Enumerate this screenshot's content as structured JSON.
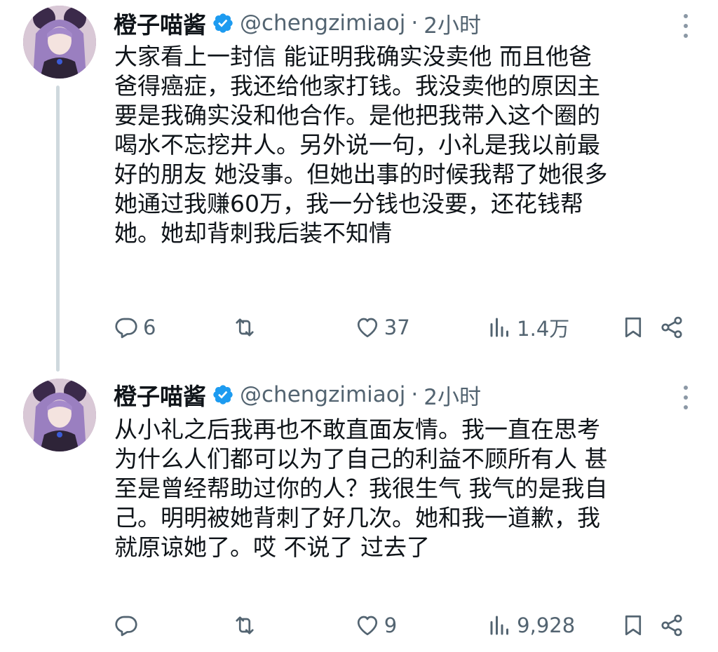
{
  "colors": {
    "text": "#0f1419",
    "secondary": "#536471",
    "verified": "#1d9bf0",
    "thread_line": "#cfd9de"
  },
  "icons": [
    "verified-badge-icon",
    "more-icon",
    "reply-icon",
    "retweet-icon",
    "like-icon",
    "views-icon",
    "bookmark-icon",
    "share-icon"
  ],
  "tweets": [
    {
      "name": "橙子喵酱",
      "handle": "@chengzimiaoj",
      "separator": "·",
      "time": "2小时",
      "text": "大家看上一封信 能证明我确实没卖他 而且他爸\n爸得癌症，我还给他家打钱。我没卖他的原因主\n要是我确实没和他合作。是他把我带入这个圈的\n喝水不忘挖井人。另外说一句，小礼是我以前最\n好的朋友 她没事。但她出事的时候我帮了她很多\n她通过我赚60万，我一分钱也没要，还花钱帮\n她。她却背刺我后装不知情",
      "replies": "6",
      "retweets": "",
      "likes": "37",
      "views": "1.4万"
    },
    {
      "name": "橙子喵酱",
      "handle": "@chengzimiaoj",
      "separator": "·",
      "time": "2小时",
      "text": "从小礼之后我再也不敢直面友情。我一直在思考\n为什么人们都可以为了自己的利益不顾所有人 甚\n至是曾经帮助过你的人？我很生气 我气的是我自\n己。明明被她背刺了好几次。她和我一道歉，我\n就原谅她了。哎 不说了 过去了",
      "replies": "",
      "retweets": "",
      "likes": "9",
      "views": "9,928"
    }
  ]
}
